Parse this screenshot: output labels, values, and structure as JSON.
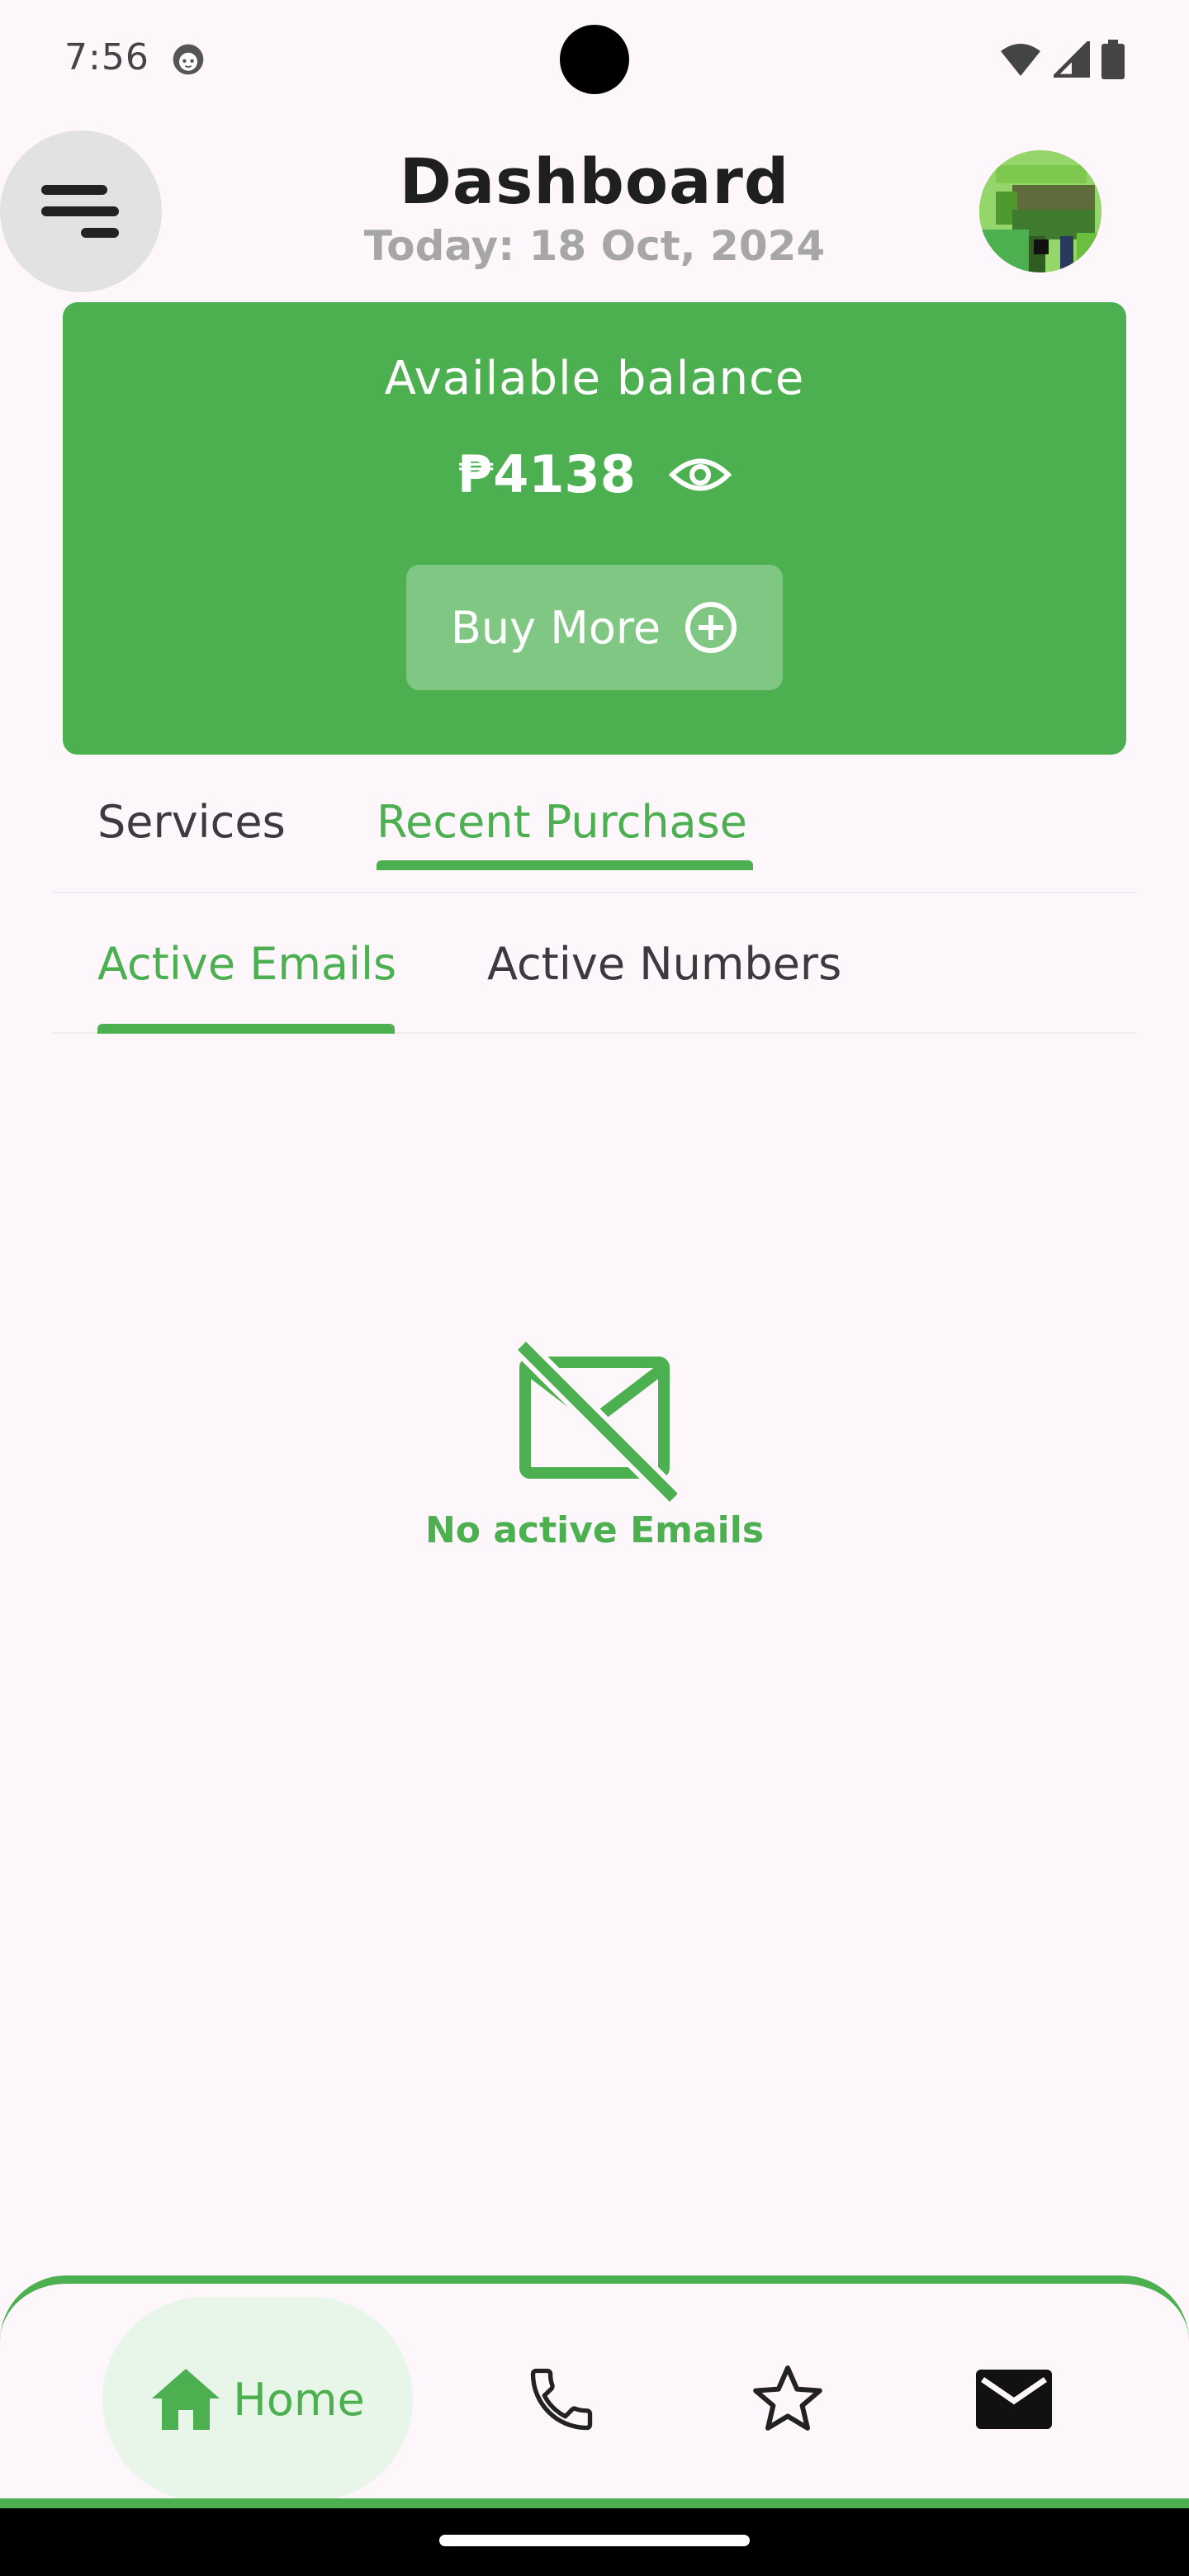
{
  "status_bar": {
    "time": "7:56",
    "notification_icon": "face-icon",
    "wifi_icon": "wifi-icon",
    "signal_icon": "signal-icon",
    "battery_icon": "battery-icon"
  },
  "header": {
    "menu_icon": "menu-icon",
    "title": "Dashboard",
    "date": "Today: 18 Oct, 2024",
    "avatar_icon": "avatar"
  },
  "balance_card": {
    "label": "Available balance",
    "value": "₱4138",
    "visibility_icon": "eye-icon",
    "buy_more_label": "Buy More",
    "buy_more_icon": "add-circle-icon"
  },
  "main_tabs": [
    {
      "label": "Services",
      "active": false
    },
    {
      "label": "Recent Purchase",
      "active": true
    }
  ],
  "sub_tabs": [
    {
      "label": "Active Emails",
      "active": true
    },
    {
      "label": "Active Numbers",
      "active": false
    }
  ],
  "empty_state": {
    "icon": "no-email-icon",
    "text": "No active Emails"
  },
  "bottom_nav": {
    "home_label": "Home",
    "items": [
      "home-icon",
      "phone-icon",
      "star-icon",
      "mail-icon"
    ]
  },
  "colors": {
    "accent": "#4caf50",
    "accent_light": "#81c784",
    "background": "#fdf7fc",
    "muted_text": "#a6a6a6"
  }
}
